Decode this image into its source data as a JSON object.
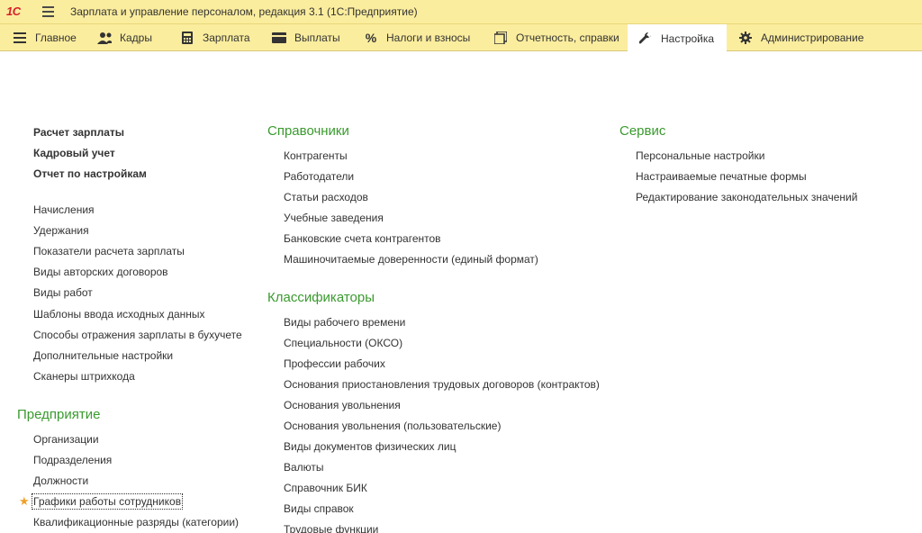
{
  "window": {
    "logo": "1С",
    "title": "Зарплата и управление персоналом, редакция 3.1  (1С:Предприятие)"
  },
  "sections": [
    {
      "label": "Главное",
      "icon": "list-menu-icon"
    },
    {
      "label": "Кадры",
      "icon": "people-icon"
    },
    {
      "label": "Зарплата",
      "icon": "calculator-icon"
    },
    {
      "label": "Выплаты",
      "icon": "wallet-icon"
    },
    {
      "label": "Налоги и взносы",
      "icon": "percent-icon"
    },
    {
      "label": "Отчетность, справки",
      "icon": "reports-icon"
    },
    {
      "label": "Настройка",
      "icon": "wrench-icon"
    },
    {
      "label": "Администрирование",
      "icon": "gear-icon"
    }
  ],
  "active_section": "Настройка",
  "left": {
    "bold_links": [
      "Расчет зарплаты",
      "Кадровый учет",
      "Отчет по настройкам"
    ],
    "links": [
      "Начисления",
      "Удержания",
      "Показатели расчета зарплаты",
      "Виды авторских договоров",
      "Виды работ",
      "Шаблоны ввода исходных данных",
      "Способы отражения зарплаты в бухучете",
      "Дополнительные настройки",
      "Сканеры штрихкода"
    ],
    "enterprise": {
      "title": "Предприятие",
      "links": [
        "Организации",
        "Подразделения",
        "Должности",
        "Графики работы сотрудников",
        "Квалификационные разряды (категории)"
      ]
    }
  },
  "middle": {
    "directories": {
      "title": "Справочники",
      "links": [
        "Контрагенты",
        "Работодатели",
        "Статьи расходов",
        "Учебные заведения",
        "Банковские счета контрагентов",
        "Машиночитаемые доверенности (единый формат)"
      ]
    },
    "classifiers": {
      "title": "Классификаторы",
      "links": [
        "Виды рабочего времени",
        "Специальности (ОКСО)",
        "Профессии рабочих",
        "Основания приостановления трудовых договоров (контрактов)",
        "Основания увольнения",
        "Основания увольнения (пользовательские)",
        "Виды документов физических лиц",
        "Валюты",
        "Справочник БИК",
        "Виды справок",
        "Трудовые функции"
      ]
    }
  },
  "right": {
    "service": {
      "title": "Сервис",
      "links": [
        "Персональные настройки",
        "Настраиваемые печатные формы",
        "Редактирование законодательных значений"
      ]
    }
  },
  "colors": {
    "panel": "#fbed9e",
    "group_title": "#3a9a2e",
    "favorite_star": "#f0a028"
  }
}
